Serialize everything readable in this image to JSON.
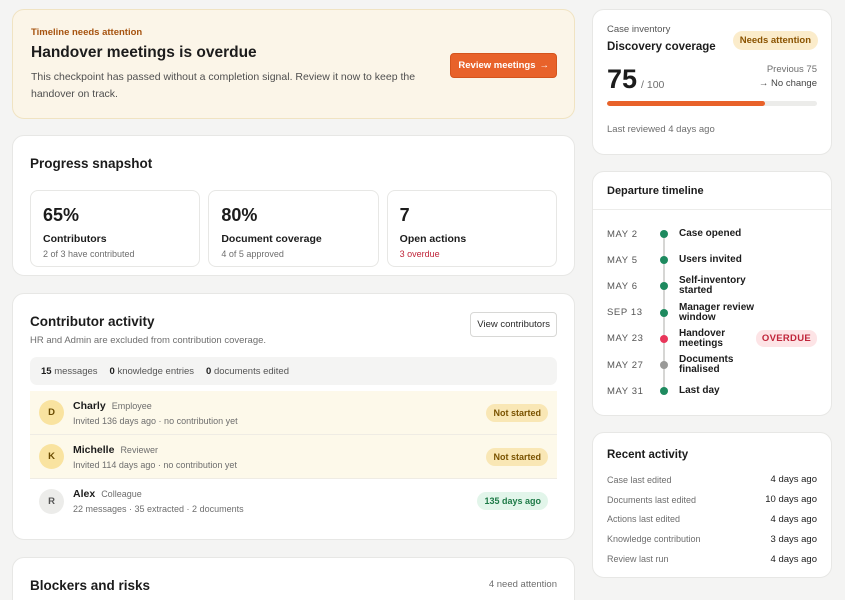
{
  "alert": {
    "kicker": "Timeline needs attention",
    "title": "Handover meetings is overdue",
    "description": "This checkpoint has passed without a completion signal. Review it now to keep the handover on track.",
    "button_label": "Review meetings",
    "button_icon": "arrow-right-icon"
  },
  "progress": {
    "title": "Progress snapshot",
    "stats": [
      {
        "value": "65%",
        "label": "Contributors",
        "sub": "2 of 3 have contributed"
      },
      {
        "value": "80%",
        "label": "Document coverage",
        "sub": "4 of 5 approved"
      },
      {
        "value": "7",
        "label": "Open actions",
        "sub": "3 overdue"
      }
    ]
  },
  "contributors": {
    "title": "Contributor activity",
    "subtitle": "HR and Admin are excluded from contribution coverage.",
    "button_label": "View contributors",
    "counts": [
      {
        "value": "15",
        "label": "messages"
      },
      {
        "value": "0",
        "label": "knowledge entries"
      },
      {
        "value": "0",
        "label": "documents edited"
      }
    ],
    "people": [
      {
        "initial": "D",
        "name": "Charly",
        "role": "Employee",
        "detail": "Invited 136 days ago · no contribution yet",
        "status": "Not started"
      },
      {
        "initial": "K",
        "name": "Michelle",
        "role": "Reviewer",
        "detail": "Invited 114 days ago · no contribution yet",
        "status": "Not started"
      },
      {
        "initial": "R",
        "name": "Alex",
        "role": "Colleague",
        "detail": "22 messages · 35 extracted · 2 documents",
        "status": "135 days ago"
      }
    ]
  },
  "blockers": {
    "title": "Blockers and risks",
    "count": "4 need attention"
  },
  "inventory": {
    "kicker": "Case inventory",
    "title": "Discovery coverage",
    "badge": "Needs attention",
    "score": "75",
    "score_max": "/ 100",
    "progress": 0.75,
    "previous": "Previous 75",
    "change": "→ No change",
    "footer": "Last reviewed 4 days ago",
    "accent_color": "#e8622a"
  },
  "timeline": {
    "title": "Departure timeline",
    "items": [
      {
        "date": "MAY 2",
        "label": "Case opened",
        "dot": "#1e8a5f"
      },
      {
        "date": "MAY 5",
        "label": "Users invited",
        "dot": "#1e8a5f"
      },
      {
        "date": "MAY 6",
        "label": "Self-inventory started",
        "dot": "#1e8a5f"
      },
      {
        "date": "SEP 13",
        "label": "Manager review window",
        "dot": "#1e8a5f"
      },
      {
        "date": "MAY 23",
        "label": "Handover meetings",
        "dot": "#e8365a",
        "badge": "OVERDUE"
      },
      {
        "date": "MAY 27",
        "label": "Documents finalised",
        "dot": "#9a9a98"
      },
      {
        "date": "MAY 31",
        "label": "Last day",
        "dot": "#1e8a5f"
      }
    ]
  },
  "recent": {
    "title": "Recent activity",
    "rows": [
      {
        "label": "Case last edited",
        "value": "4 days ago"
      },
      {
        "label": "Documents last edited",
        "value": "10 days ago"
      },
      {
        "label": "Actions last edited",
        "value": "4 days ago"
      },
      {
        "label": "Knowledge contribution",
        "value": "3 days ago"
      },
      {
        "label": "Review last run",
        "value": "4 days ago"
      }
    ]
  }
}
